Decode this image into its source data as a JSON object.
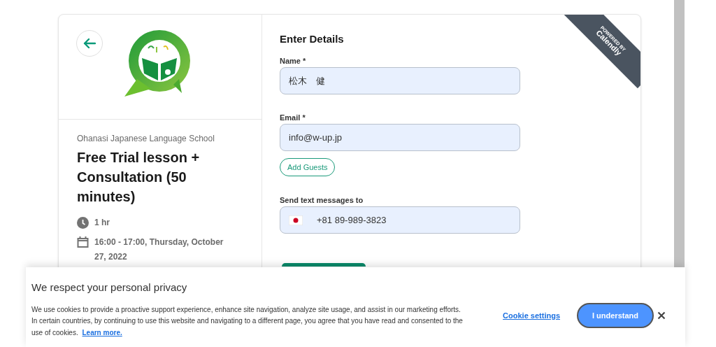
{
  "ribbon": {
    "line1": "POWERED BY",
    "line2": "Calendly"
  },
  "event": {
    "organizer": "Ohanasi Japanese Language School",
    "title": "Free Trial lesson + Consultation (50 minutes)",
    "duration": "1 hr",
    "datetime": "16:00 - 17:00, Thursday, October 27, 2022"
  },
  "form": {
    "heading": "Enter Details",
    "fields": [
      {
        "kind": "text",
        "label": "Name *",
        "value": "松木　健"
      },
      {
        "kind": "text",
        "label": "Email *",
        "value": "info@w-up.jp"
      },
      {
        "kind": "guests",
        "label": "Add Guests"
      },
      {
        "kind": "phone",
        "label": "Send text messages to",
        "value": "+81 89-989-3823"
      }
    ]
  },
  "cookie_banner": {
    "title": "We respect your personal privacy",
    "body": "We use cookies to provide a proactive support experience, enhance site navigation, analyze site usage, and assist in our marketing efforts. In certain countries, by continuing to use this website and navigating to a different page, you agree that you have read and consented to the use of cookies.",
    "learn_more": "Learn more.",
    "settings": "Cookie settings",
    "accept": "I understand"
  }
}
